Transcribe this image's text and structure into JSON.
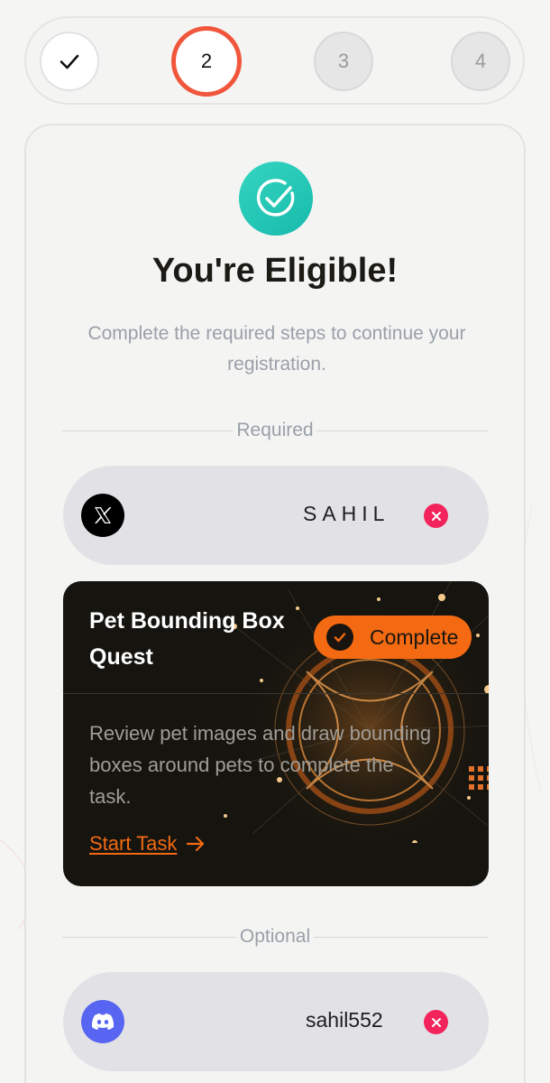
{
  "stepper": {
    "steps": [
      {
        "label": "",
        "state": "done"
      },
      {
        "label": "2",
        "state": "current"
      },
      {
        "label": "3",
        "state": "upcoming"
      },
      {
        "label": "4",
        "state": "upcoming"
      }
    ]
  },
  "eligibility": {
    "title": "You're Eligible!",
    "subtitle": "Complete the required steps to continue your registration."
  },
  "required": {
    "section_label": "Required",
    "x_account": {
      "icon": "x-logo-icon",
      "handle": "SAHIL"
    },
    "quest": {
      "title": "Pet Bounding Box Quest",
      "status": "Complete",
      "description": "Review pet images and draw bounding boxes around pets to complete the task.",
      "action_label": "Start Task"
    }
  },
  "optional": {
    "section_label": "Optional",
    "discord_account": {
      "icon": "discord-icon",
      "handle": "sahil552"
    }
  },
  "colors": {
    "accent_orange": "#f36a12",
    "active_step_ring": "#f0563b",
    "success_teal": "#1fc6b4",
    "remove_red": "#f2245b",
    "discord_blue": "#5865f2"
  }
}
